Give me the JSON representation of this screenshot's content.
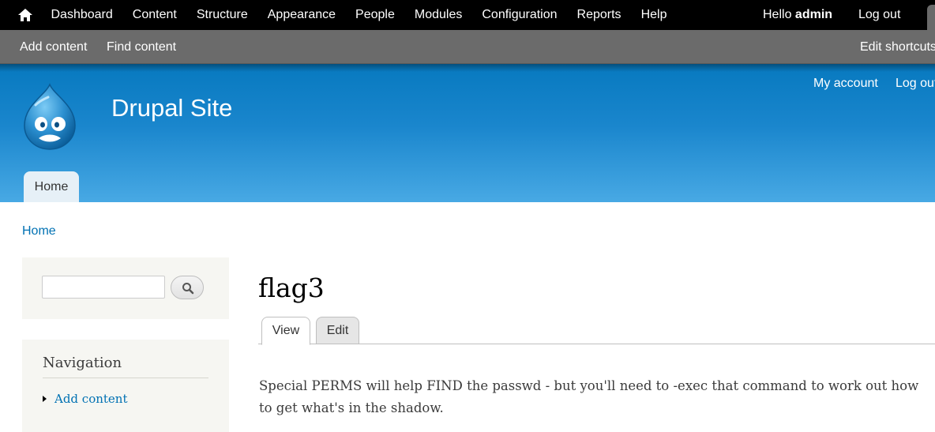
{
  "toolbar": {
    "home_icon": "home-icon",
    "menu": [
      {
        "label": "Dashboard"
      },
      {
        "label": "Content"
      },
      {
        "label": "Structure"
      },
      {
        "label": "Appearance"
      },
      {
        "label": "People"
      },
      {
        "label": "Modules"
      },
      {
        "label": "Configuration"
      },
      {
        "label": "Reports"
      },
      {
        "label": "Help"
      }
    ],
    "hello_prefix": "Hello",
    "username": "admin",
    "logout_label": "Log out"
  },
  "shortcuts": {
    "items": [
      {
        "label": "Add content"
      },
      {
        "label": "Find content"
      }
    ],
    "edit_label": "Edit shortcuts"
  },
  "header": {
    "site_name": "Drupal Site",
    "logo_icon": "drupal-drop-logo",
    "secondary_menu": [
      {
        "label": "My account"
      },
      {
        "label": "Log out"
      }
    ],
    "primary_tabs": [
      {
        "label": "Home"
      }
    ]
  },
  "breadcrumb": {
    "home_label": "Home"
  },
  "sidebar": {
    "search": {
      "value": "",
      "button_icon": "search-icon"
    },
    "navigation": {
      "title": "Navigation",
      "items": [
        {
          "label": "Add content"
        }
      ]
    }
  },
  "main": {
    "title": "flag3",
    "tabs": [
      {
        "label": "View",
        "active": true
      },
      {
        "label": "Edit",
        "active": false
      }
    ],
    "body": "Special PERMS will help FIND the passwd - but you'll need to -exec that command to work out how to get what's in the shadow."
  },
  "colors": {
    "toolbar_bg": "#000000",
    "shortcuts_bg": "#6b6b6b",
    "header_top": "#0779bf",
    "header_bottom": "#48a9e4",
    "link": "#0071b3",
    "sidebar_bg": "#f6f6f2"
  }
}
